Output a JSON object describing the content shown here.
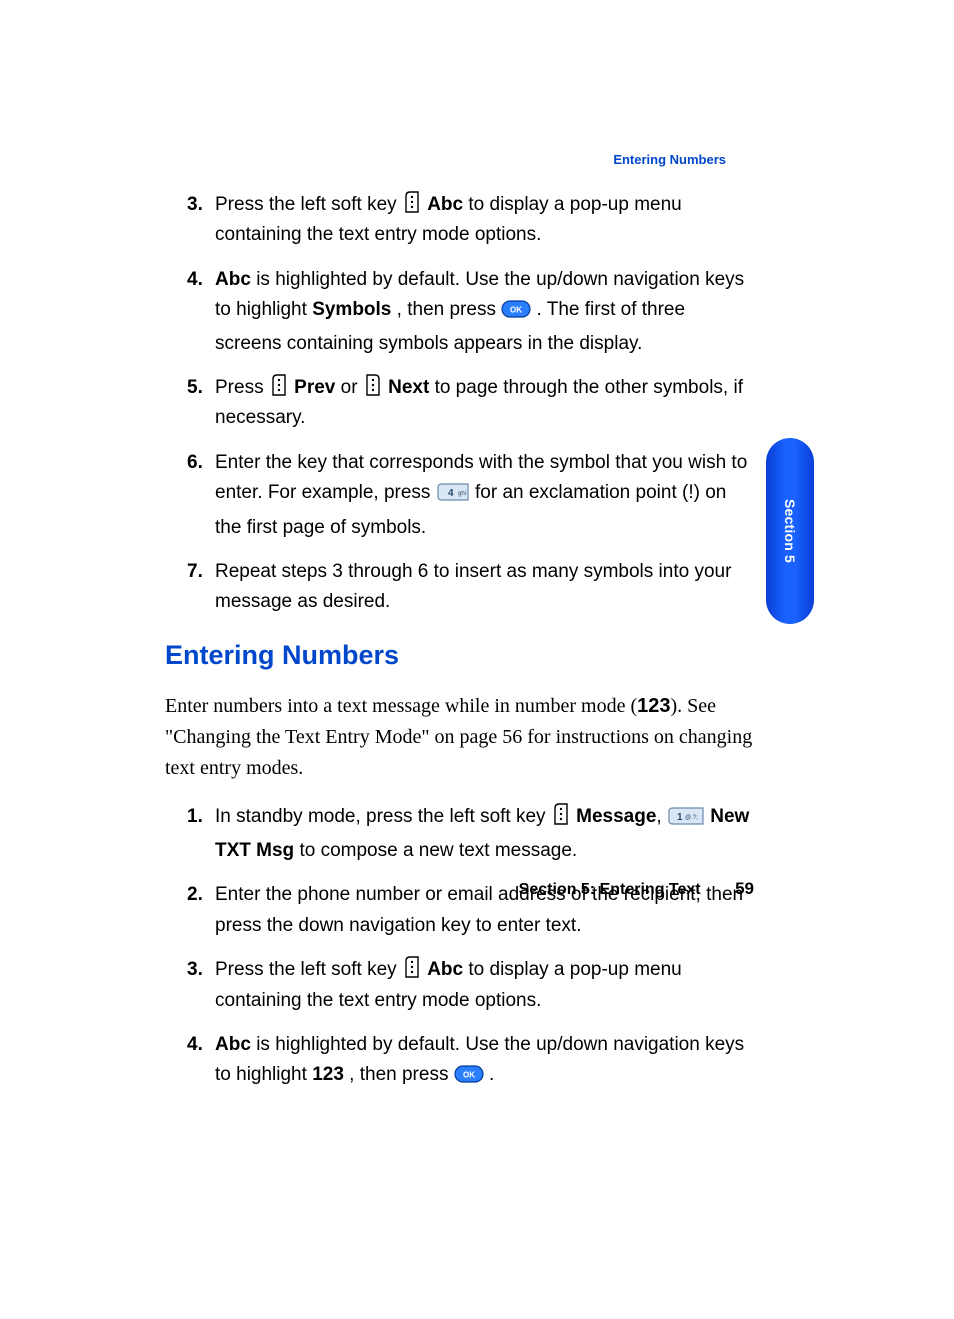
{
  "header": {
    "running_title": "Entering Numbers"
  },
  "list_a": {
    "items": [
      {
        "n": "3.",
        "pre": "Press the left soft key ",
        "bold": "Abc",
        "post": " to display a pop-up menu containing the text entry mode options."
      },
      {
        "n": "4.",
        "b1": "Abc",
        "t1": " is highlighted by default. Use the up/down navigation keys to highlight ",
        "b2": "Symbols",
        "t2": ", then press ",
        "t3": ". The first of three screens containing symbols appears in the display."
      },
      {
        "n": "5.",
        "t1": "Press ",
        "b1": "Prev",
        "t2": " or ",
        "b2": "Next",
        "t3": " to page through the other symbols, if necessary."
      },
      {
        "n": "6.",
        "t1": "Enter the key that corresponds with the symbol that you wish to enter. For example, press ",
        "t2": " for an exclamation point (!) on the first page of symbols."
      },
      {
        "n": "7.",
        "t1": "Repeat steps 3 through 6 to insert as many symbols into your message as desired."
      }
    ]
  },
  "heading": "Entering Numbers",
  "intro": {
    "t1": "Enter numbers into a text message while in number mode (",
    "b1": "123",
    "t2": "). See \"Changing the Text Entry Mode\" on page 56 for instructions on changing text entry modes."
  },
  "list_b": {
    "items": [
      {
        "n": "1.",
        "t1": "In standby mode, press the left soft key ",
        "b1": "Message",
        "t2": ", ",
        "b2": "New TXT Msg",
        "t3": " to compose a new text message."
      },
      {
        "n": "2.",
        "t1": "Enter the phone number or email address of the recipient, then press the down navigation key to enter text."
      },
      {
        "n": "3.",
        "t1": "Press the left soft key ",
        "b1": "Abc",
        "t2": " to display a pop-up menu containing the text entry mode options."
      },
      {
        "n": "4.",
        "b1": "Abc",
        "t1": " is highlighted by default. Use the up/down navigation keys to highlight ",
        "b2": "123",
        "t2": ", then press ",
        "t3": "."
      }
    ]
  },
  "side_tab": "Section 5",
  "footer": {
    "label": "Section 5: Entering Text",
    "page": "59"
  }
}
